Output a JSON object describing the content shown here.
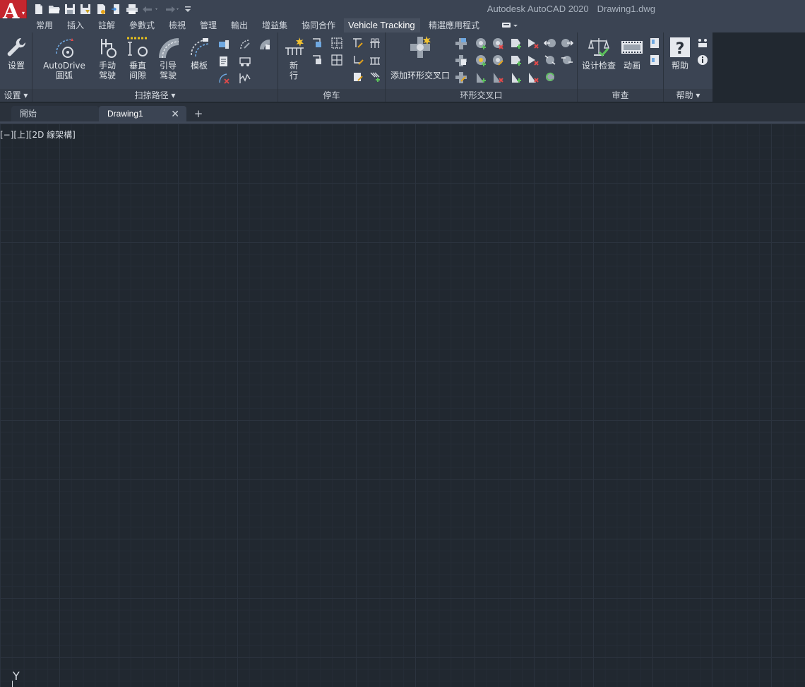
{
  "app": {
    "logo_letter": "A",
    "window_title": "Autodesk AutoCAD 2020",
    "file_name": "Drawing1.dwg"
  },
  "quick_access": [
    "new-icon",
    "open-icon",
    "save-icon",
    "save-as-icon",
    "publish-icon",
    "export-icon",
    "plot-icon",
    "undo-icon",
    "redo-icon",
    "customize-icon"
  ],
  "ribbon_tabs": [
    "常用",
    "插入",
    "註解",
    "參數式",
    "檢視",
    "管理",
    "輸出",
    "增益集",
    "協同合作",
    "Vehicle Tracking",
    "精選應用程式"
  ],
  "active_tab": "Vehicle Tracking",
  "panels": {
    "settings": {
      "title": "设置",
      "btn_settings": "设置"
    },
    "swept_path": {
      "title": "扫掠路径",
      "btn_autodrive_1": "AutoDrive",
      "btn_autodrive_2": "圆弧",
      "btn_manual_1": "手动",
      "btn_manual_2": "驾驶",
      "btn_clearance_1": "垂直",
      "btn_clearance_2": "间隙",
      "btn_guided_1": "引导",
      "btn_guided_2": "驾驶",
      "btn_template": "模板"
    },
    "parking": {
      "title": "停车",
      "btn_new_row_1": "新",
      "btn_new_row_2": "行"
    },
    "roundabout": {
      "title": "环形交叉口",
      "btn_add_roundabout": "添加环形交叉口"
    },
    "review": {
      "title": "审查",
      "btn_design_check": "设计检查",
      "btn_animation": "动画"
    },
    "help": {
      "title": "帮助",
      "btn_help": "帮助"
    }
  },
  "doc_tabs": {
    "start": "開始",
    "drawing": "Drawing1",
    "close": "✕",
    "add": "+"
  },
  "viewport": {
    "label": "[−][上][2D 線架構]",
    "ucs_axis": "Y"
  },
  "colors": {
    "accent": "#c4262e",
    "ribbon": "#3b4453",
    "canvas": "#212830"
  }
}
